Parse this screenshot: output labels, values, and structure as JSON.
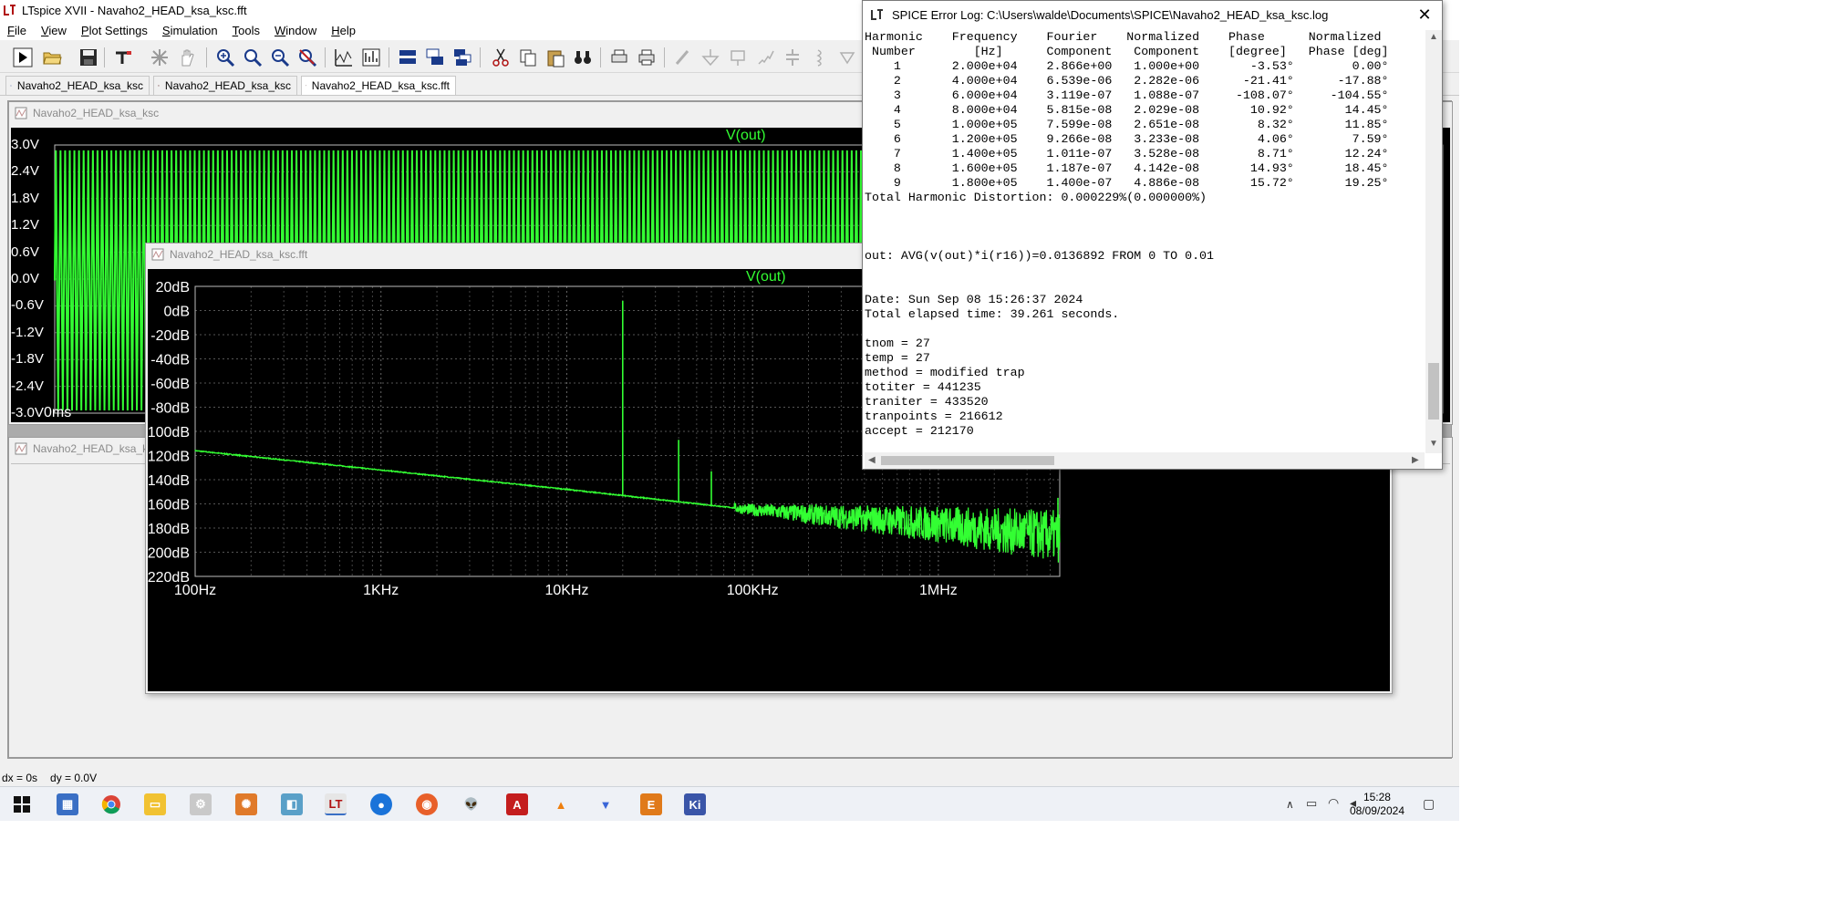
{
  "window": {
    "title": "LTspice XVII - Navaho2_HEAD_ksa_ksc.fft"
  },
  "menu": [
    "File",
    "View",
    "Plot Settings",
    "Simulation",
    "Tools",
    "Window",
    "Help"
  ],
  "tabs": [
    {
      "label": "Navaho2_HEAD_ksa_ksc",
      "icon": "schematic-icon"
    },
    {
      "label": "Navaho2_HEAD_ksa_ksc",
      "icon": "waveform-icon"
    },
    {
      "label": "Navaho2_HEAD_ksa_ksc.fft",
      "icon": "waveform-icon"
    }
  ],
  "transient_window": {
    "title": "Navaho2_HEAD_ksa_ksc",
    "trace": "V(out)",
    "y_ticks": [
      "3.0V",
      "2.4V",
      "1.8V",
      "1.2V",
      "0.6V",
      "0.0V",
      "-0.6V",
      "-1.2V",
      "-1.8V",
      "-2.4V",
      "-3.0V"
    ],
    "x_tick": "0ms"
  },
  "third_window": {
    "title": "Navaho2_HEAD_ksa_ksc"
  },
  "fft_window": {
    "title": "Navaho2_HEAD_ksa_ksc.fft",
    "trace": "V(out)"
  },
  "chart_data": {
    "type": "line",
    "x_scale": "log",
    "xlim": [
      100,
      4500000
    ],
    "ylim": [
      -220,
      20
    ],
    "y_ticks": [
      "20dB",
      "0dB",
      "-20dB",
      "-40dB",
      "-60dB",
      "-80dB",
      "-100dB",
      "-120dB",
      "-140dB",
      "-160dB",
      "-180dB",
      "-200dB",
      "-220dB"
    ],
    "y_tick_values": [
      20,
      0,
      -20,
      -40,
      -60,
      -80,
      -100,
      -120,
      -140,
      -160,
      -180,
      -200,
      -220
    ],
    "x_ticks": [
      "100Hz",
      "1KHz",
      "10KHz",
      "100KHz",
      "1MHz"
    ],
    "x_tick_values": [
      100,
      1000,
      10000,
      100000,
      1000000
    ],
    "grid": true,
    "series": [
      {
        "name": "V(out)",
        "color": "#33ff33",
        "noise_floor": {
          "x": [
            100,
            1000,
            10000,
            100000,
            1000000,
            4500000
          ],
          "y": [
            -116,
            -132,
            -148,
            -165,
            -177,
            -187
          ]
        },
        "spikes": [
          {
            "x": 20000,
            "y": 8
          },
          {
            "x": 40000,
            "y": -107
          },
          {
            "x": 60000,
            "y": -133
          },
          {
            "x": 80000,
            "y": -160
          },
          {
            "x": 4400000,
            "y": -155
          }
        ]
      }
    ]
  },
  "log_window": {
    "title": "SPICE Error Log: C:\\Users\\walde\\Documents\\SPICE\\Navaho2_HEAD_ksa_ksc.log",
    "lines": [
      "Harmonic    Frequency    Fourier    Normalized    Phase      Normalized",
      " Number        [Hz]      Component   Component    [degree]   Phase [deg]",
      "    1       2.000e+04    2.866e+00   1.000e+00       -3.53°        0.00°",
      "    2       4.000e+04    6.539e-06   2.282e-06      -21.41°      -17.88°",
      "    3       6.000e+04    3.119e-07   1.088e-07     -108.07°     -104.55°",
      "    4       8.000e+04    5.815e-08   2.029e-08       10.92°       14.45°",
      "    5       1.000e+05    7.599e-08   2.651e-08        8.32°       11.85°",
      "    6       1.200e+05    9.266e-08   3.233e-08        4.06°        7.59°",
      "    7       1.400e+05    1.011e-07   3.528e-08        8.71°       12.24°",
      "    8       1.600e+05    1.187e-07   4.142e-08       14.93°       18.45°",
      "    9       1.800e+05    1.400e-07   4.886e-08       15.72°       19.25°",
      "Total Harmonic Distortion: 0.000229%(0.000000%)",
      "",
      "",
      "",
      "out: AVG(v(out)*i(r16))=0.0136892 FROM 0 TO 0.01",
      "",
      "",
      "Date: Sun Sep 08 15:26:37 2024",
      "Total elapsed time: 39.261 seconds.",
      "",
      "tnom = 27",
      "temp = 27",
      "method = modified trap",
      "totiter = 441235",
      "traniter = 433520",
      "tranpoints = 216612",
      "accept = 212170"
    ]
  },
  "status": {
    "dx": "dx = 0s",
    "dy": "dy = 0.0V"
  },
  "clock": {
    "time": "15:28",
    "date": "08/09/2024"
  },
  "taskbar_icons": [
    "windows-start-icon",
    "calculator-icon",
    "chrome-icon",
    "file-explorer-icon",
    "app-icon",
    "settings-app-icon",
    "app-icon",
    "ltspice-icon",
    "app-icon",
    "firefox-icon",
    "alien-icon",
    "pdf-reader-icon",
    "vlc-icon",
    "app-icon",
    "app-icon",
    "kicad-icon"
  ],
  "colors": {
    "trace": "#33ff33",
    "plot_bg": "#000000",
    "window_bg": "#f0f0f0"
  }
}
